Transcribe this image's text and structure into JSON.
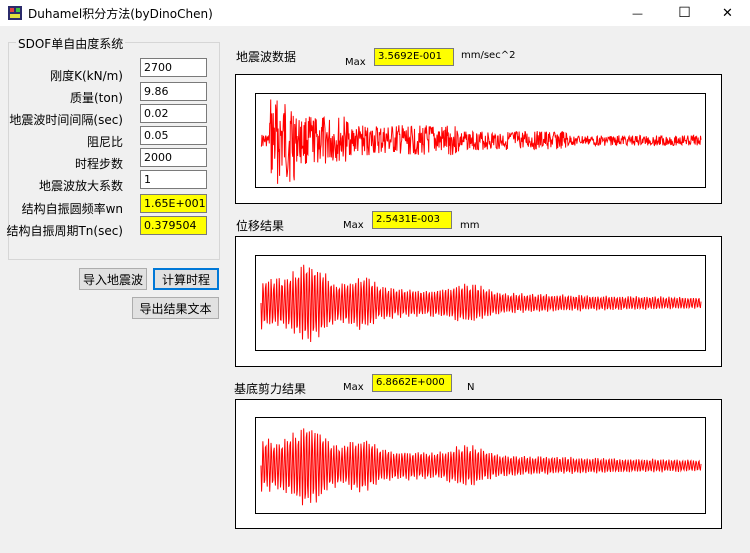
{
  "window": {
    "title": "Duhamel积分方法(byDinoChen)",
    "minimize_glyph": "—",
    "maximize_glyph": "☐",
    "close_glyph": "✕"
  },
  "params": {
    "group_title": "SDOF单自由度系统",
    "rows": [
      {
        "label": "刚度K(kN/m)",
        "value": "2700"
      },
      {
        "label": "质量(ton)",
        "value": "9.86"
      },
      {
        "label": "地震波时间间隔(sec)",
        "value": "0.02"
      },
      {
        "label": "阻尼比",
        "value": "0.05"
      },
      {
        "label": "时程步数",
        "value": "2000"
      },
      {
        "label": "地震波放大系数",
        "value": "1"
      },
      {
        "label": "结构自振圆频率wn",
        "value": "1.65E+001"
      },
      {
        "label": "结构自振周期Tn(sec)",
        "value": "0.379504"
      }
    ]
  },
  "buttons": {
    "import_label": "导入地震波",
    "compute_label": "计算时程",
    "export_label": "导出结果文本"
  },
  "plots": [
    {
      "title": "地震波数据",
      "max_label": "Max",
      "max_value": "3.5692E-001",
      "unit": "mm/sec^2",
      "color": "#ff0000"
    },
    {
      "title": "位移结果",
      "max_label": "Max",
      "max_value": "2.5431E-003",
      "unit": "mm",
      "color": "#ff0000"
    },
    {
      "title": "基底剪力结果",
      "max_label": "Max",
      "max_value": "6.8662E+000",
      "unit": "N",
      "color": "#ff0000"
    }
  ]
}
